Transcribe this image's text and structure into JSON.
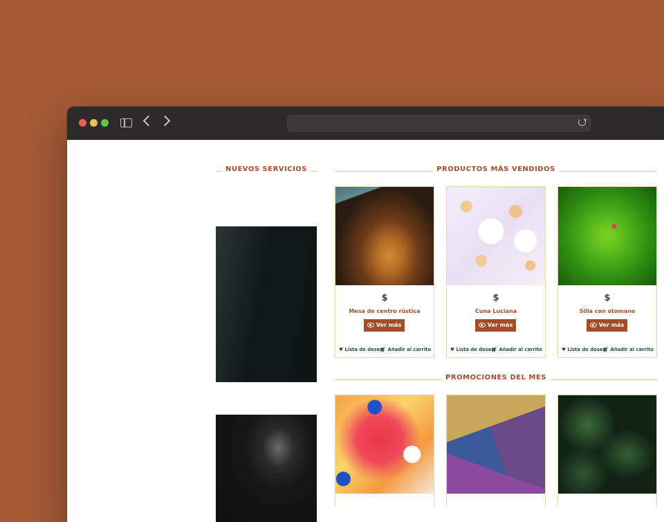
{
  "colors": {
    "brand": "#a24e2a",
    "price_text": "#2b4c44",
    "card_border": "#e4d8a8",
    "page_background": "#a45a35"
  },
  "browser": {
    "icons": [
      "sidebar-icon",
      "back-icon",
      "forward-icon",
      "reload-icon"
    ]
  },
  "sections": {
    "nuevos_servicios": "NUEVOS SERVICIOS",
    "mas_vendidos": "PRODUCTOS MÁS VENDIDOS",
    "promociones": "PROMOCIONES DEL MES"
  },
  "products": [
    {
      "price": "$",
      "name": "Mesa de centro rústica",
      "button": "Ver más",
      "wishlist": "Lista de deseo",
      "cart": "Añadir al carrito"
    },
    {
      "price": "$",
      "name": "Cuna Luciana",
      "button": "Ver más",
      "wishlist": "Lista de deseo",
      "cart": "Añadir al carrito"
    },
    {
      "price": "$",
      "name": "Silla con otomano",
      "button": "Ver más",
      "wishlist": "Lista de deseo",
      "cart": "Añadir al carrito"
    }
  ]
}
